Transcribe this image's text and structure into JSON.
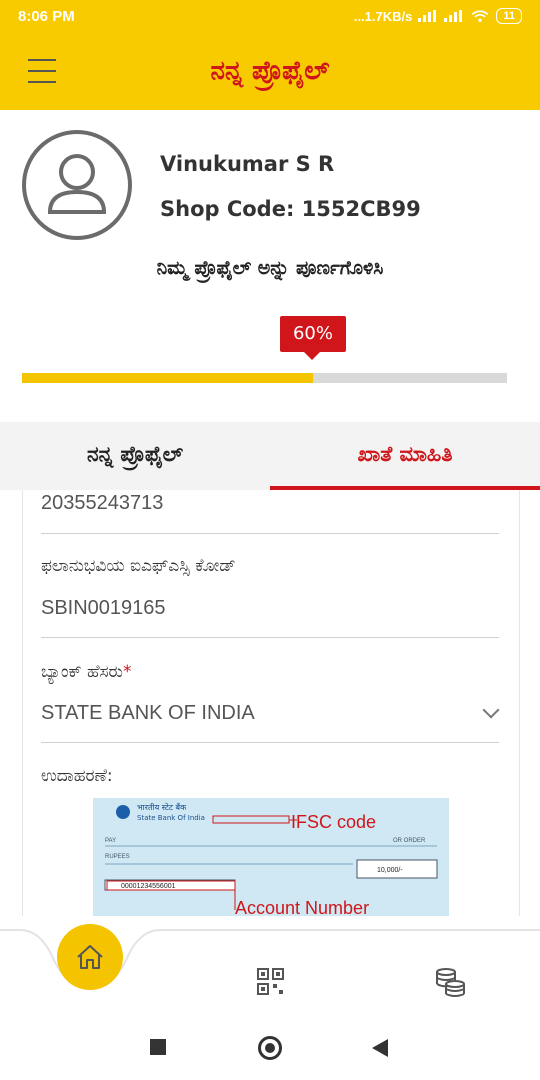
{
  "status_bar": {
    "time": "8:06 PM",
    "network_speed": "...1.7KB/s",
    "battery": "11"
  },
  "app_bar": {
    "title": "ನನ್ನ ಪ್ರೊಫೈಲ್",
    "menu_icon": "hamburger-icon"
  },
  "profile": {
    "name": "Vinukumar S R",
    "shop_code": "Shop Code: 1552CB99",
    "complete_prompt": "ನಿಮ್ಮ ಪ್ರೊಫೈಲ್ ಅನ್ನು ಪೂರ್ಣಗೊಳಿಸಿ",
    "progress_label": "60%",
    "progress_fraction": 0.6
  },
  "tabs": [
    {
      "label": "ನನ್ನ ಪ್ರೊಫೈಲ್",
      "active": false
    },
    {
      "label": "ಖಾತೆ ಮಾಹಿತಿ",
      "active": true
    }
  ],
  "account": {
    "account_number_value": "20355243713",
    "ifsc_label": "ಫಲಾನುಭವಿಯ ಐಎಫ್ಎಸ್ಸಿ ಕೋಡ್",
    "ifsc_value": "SBIN0019165",
    "bank_label": "ಬ್ಯಾಂಕ್ ಹೆಸರು",
    "bank_required": "*",
    "bank_value": "STATE BANK OF INDIA",
    "example_label": "ಉದಾಹರಣೆ:"
  },
  "cheque_example": {
    "bank_name_hi": "भारतीय स्टेट बैंक",
    "bank_name_en": "State Bank Of India",
    "pay": "PAY",
    "rupees": "RUPEES",
    "or_order": "OR ORDER",
    "amount": "10,000/-",
    "account_no": "00001234556001",
    "ifsc_annotation": "IFSC code",
    "account_annotation": "Account Number"
  },
  "bottom_nav": {
    "home_icon": "home-icon",
    "qr_icon": "qr-code-icon",
    "coins_icon": "coins-icon"
  },
  "colors": {
    "brand_yellow": "#f8cb00",
    "accent_red": "#d0161a"
  }
}
